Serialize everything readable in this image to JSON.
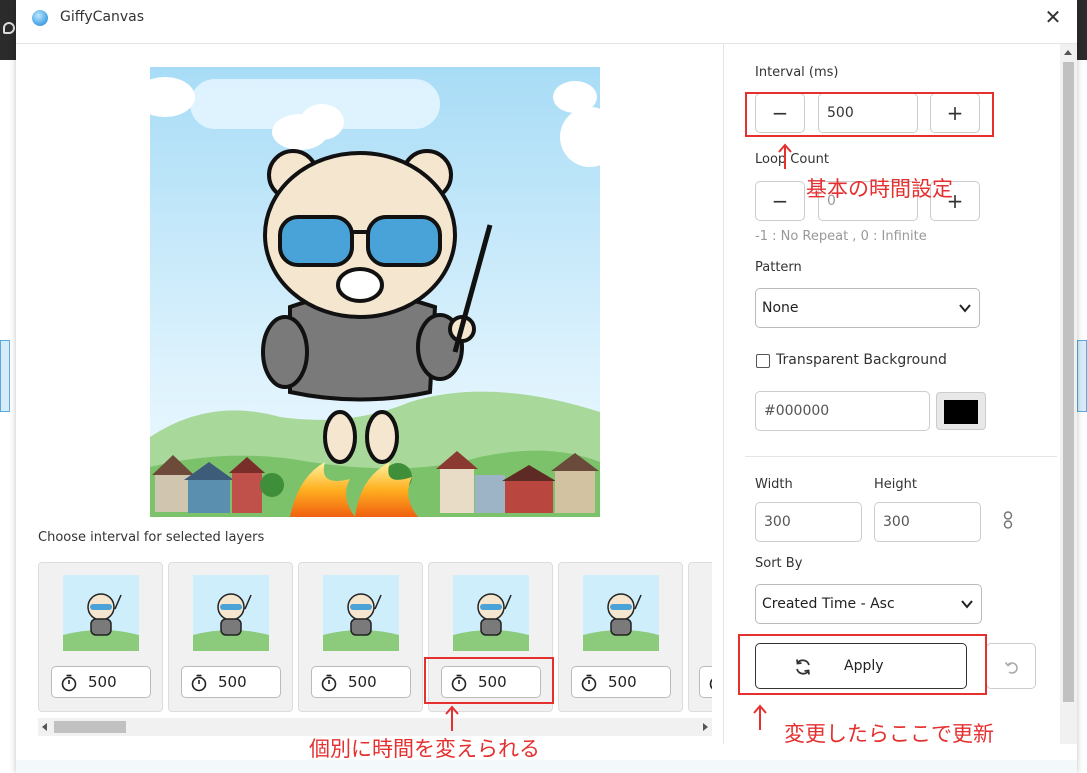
{
  "window": {
    "title": "GiffyCanvas",
    "close_label": "✕"
  },
  "left_panel": {
    "layers_label": "Choose interval for selected layers",
    "layers": [
      {
        "interval": "500"
      },
      {
        "interval": "500"
      },
      {
        "interval": "500"
      },
      {
        "interval": "500"
      },
      {
        "interval": "500"
      }
    ]
  },
  "settings": {
    "interval": {
      "label": "Interval (ms)",
      "value": "500",
      "minus": "−",
      "plus": "+"
    },
    "loop_count": {
      "label": "Loop Count",
      "value": "0",
      "minus": "−",
      "plus": "+",
      "hint": "-1 : No Repeat , 0 : Infinite"
    },
    "pattern": {
      "label": "Pattern",
      "selected": "None"
    },
    "transparent_bg": {
      "label": "Transparent Background",
      "checked": false
    },
    "background_color": {
      "value": "#000000"
    },
    "width": {
      "label": "Width",
      "value": "300"
    },
    "height": {
      "label": "Height",
      "value": "300"
    },
    "sort_by": {
      "label": "Sort By",
      "selected": "Created Time - Asc"
    },
    "apply_label": "Apply"
  },
  "annotations": {
    "interval_note": "基本の時間設定",
    "layers_note": "個別に時間を変えられる",
    "apply_note": "変更したらここで更新"
  },
  "colors": {
    "annotation": "#e53030",
    "sky": "#bfe6fb",
    "grass": "#7cc26b"
  }
}
